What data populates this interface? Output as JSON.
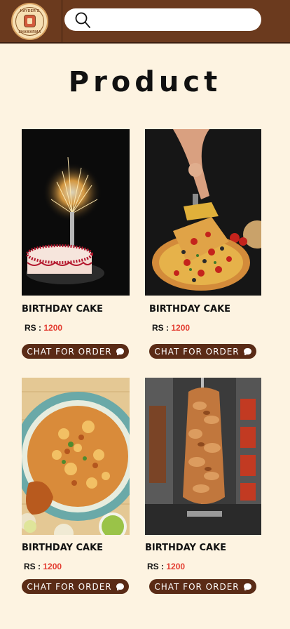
{
  "header": {
    "logo_text_top": "HAYDER'S",
    "logo_text_bottom": "SHAWARMA",
    "search_placeholder": ""
  },
  "page_title": "Product",
  "products": [
    {
      "title": "BIRTHDAY CAKE",
      "price_label": "RS :",
      "price": "1200",
      "button": "CHAT FOR ORDER",
      "image": "birthday-cake-with-sparkler"
    },
    {
      "title": "BIRTHDAY CAKE",
      "price_label": "RS :",
      "price": "1200",
      "button": "CHAT FOR ORDER",
      "image": "pizza-slice"
    },
    {
      "title": "BIRTHDAY CAKE",
      "price_label": "RS :",
      "price": "1200",
      "button": "CHAT FOR ORDER",
      "image": "chicken-biryani"
    },
    {
      "title": "BIRTHDAY CAKE",
      "price_label": "RS :",
      "price": "1200",
      "button": "CHAT FOR ORDER",
      "image": "shawarma-spit"
    }
  ],
  "colors": {
    "header": "#6b3a1e",
    "background": "#fdf3e1",
    "button": "#5a2b16",
    "price": "#e33b2f"
  }
}
